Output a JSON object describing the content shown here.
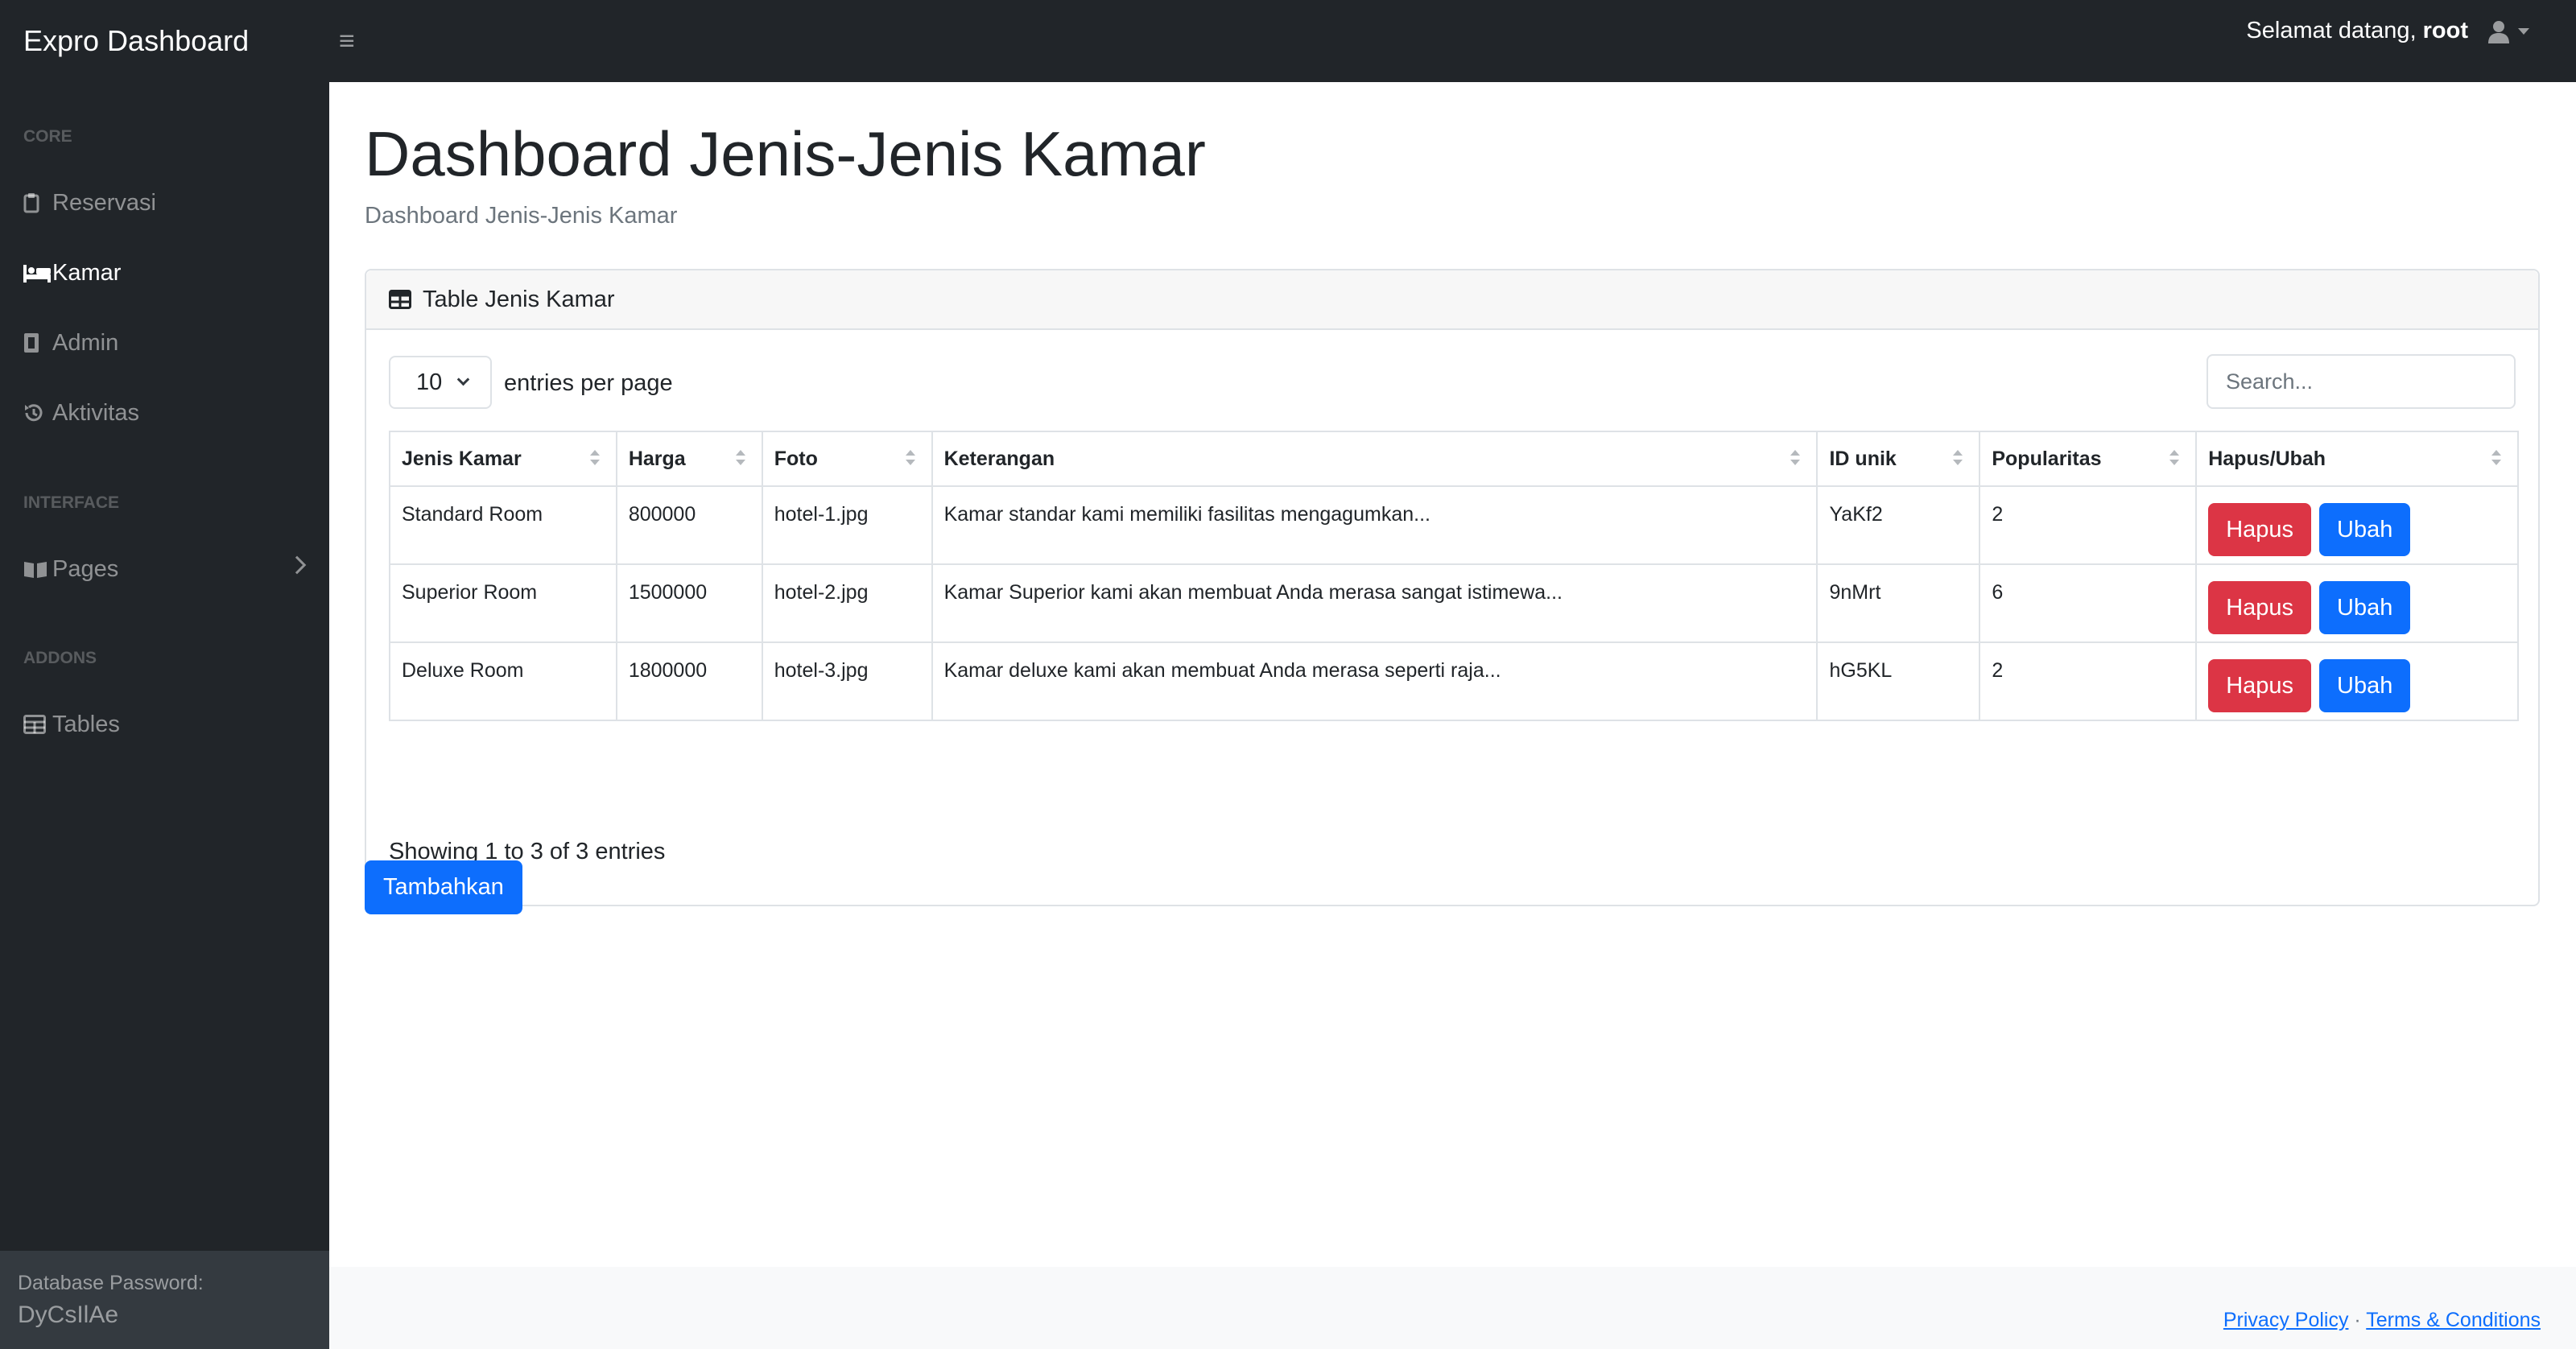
{
  "navbar": {
    "brand": "Expro Dashboard",
    "toggle_icon": "≡",
    "welcome_text": "Selamat datang,",
    "username": "root",
    "user_icon": "user-icon"
  },
  "sidebar": {
    "sections": [
      {
        "heading": "CORE"
      },
      {
        "heading": "INTERFACE"
      },
      {
        "heading": "ADDONS"
      }
    ],
    "items": [
      {
        "label": "Reservasi",
        "icon": "clipboard-icon",
        "active": false
      },
      {
        "label": "Kamar",
        "icon": "bed-icon",
        "active": true
      },
      {
        "label": "Admin",
        "icon": "id-badge-icon",
        "active": false
      },
      {
        "label": "Aktivitas",
        "icon": "history-icon",
        "active": false
      },
      {
        "label": "Pages",
        "icon": "book-open-icon",
        "active": false
      },
      {
        "label": "Tables",
        "icon": "table-icon",
        "active": false
      }
    ],
    "footer": {
      "label": "Database Password:",
      "value": "DyCsIlAe"
    }
  },
  "main": {
    "title": "Dashboard Jenis-Jenis Kamar",
    "breadcrumb": "Dashboard Jenis-Jenis Kamar",
    "card": {
      "header": "Table Jenis Kamar",
      "per_page_value": "10",
      "per_page_label": "entries per page",
      "search_placeholder": "Search...",
      "columns": [
        "Jenis Kamar",
        "Harga",
        "Foto",
        "Keterangan",
        "ID unik",
        "Popularitas",
        "Hapus/Ubah"
      ],
      "rows": [
        {
          "jenis": "Standard Room",
          "harga": "800000",
          "foto": "hotel-1.jpg",
          "keterangan": "Kamar standar kami memiliki fasilitas mengagumkan...",
          "id": "YaKf2",
          "popularitas": "2"
        },
        {
          "jenis": "Superior Room",
          "harga": "1500000",
          "foto": "hotel-2.jpg",
          "keterangan": "Kamar Superior kami akan membuat Anda merasa sangat istimewa...",
          "id": "9nMrt",
          "popularitas": "6"
        },
        {
          "jenis": "Deluxe Room",
          "harga": "1800000",
          "foto": "hotel-3.jpg",
          "keterangan": "Kamar deluxe kami akan membuat Anda merasa seperti raja...",
          "id": "hG5KL",
          "popularitas": "2"
        }
      ],
      "delete_label": "Hapus",
      "edit_label": "Ubah",
      "info": "Showing 1 to 3 of 3 entries"
    },
    "add_button": "Tambahkan"
  },
  "footer": {
    "privacy": "Privacy Policy",
    "separator": "·",
    "terms": "Terms & Conditions"
  },
  "colors": {
    "dark": "#212529",
    "danger": "#dc3545",
    "primary": "#0d6efd"
  }
}
